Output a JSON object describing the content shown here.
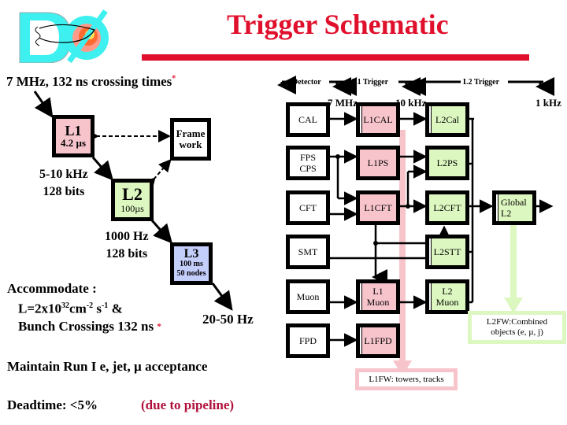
{
  "header": {
    "title": "Trigger Schematic",
    "logo": "d0-logo"
  },
  "left": {
    "crossing_line": "7 MHz, 132 ns crossing times",
    "crossing_star": "*",
    "l1": {
      "name": "L1",
      "latency": "4.2 µs"
    },
    "framework": {
      "line1": "Frame",
      "line2": "work"
    },
    "l1_rate": {
      "line1": "5-10 kHz",
      "line2": "128 bits"
    },
    "l2": {
      "name": "L2",
      "latency": "100µs"
    },
    "l2_rate": {
      "line1": "1000 Hz",
      "line2": "128 bits"
    },
    "l3": {
      "name": "L3",
      "line1": "100 ms",
      "line2": "50 nodes"
    },
    "l3_rate": "20-50 Hz",
    "accommodate": {
      "line1": "Accommodate :",
      "lum_prefix": "L=2x10",
      "lum_exp": "32",
      "lum_unit": "cm",
      "lum_unit_exp": "-2",
      "lum_s": " s",
      "lum_s_exp": "-1",
      "lum_suffix": " &",
      "line3": "Bunch Crossings 132 ns",
      "star": "*"
    },
    "maintain": "Maintain Run I e, jet, µ acceptance",
    "deadtime": "Deadtime:  <5%",
    "deadtime_note": "(due to pipeline)"
  },
  "right": {
    "stages": {
      "detector": "Detector",
      "l1": "L1 Trigger",
      "l2": "L2 Trigger"
    },
    "rates": {
      "r1": "7 MHz",
      "r2": "10 kHz",
      "r3": "1 kHz"
    },
    "detectors": [
      "CAL",
      "FPS\nCPS",
      "CFT",
      "SMT",
      "Muon",
      "FPD"
    ],
    "l1_boxes": [
      "L1CAL",
      "L1PS",
      "L1CFT",
      "L1\nMuon",
      "L1FPD"
    ],
    "l2_boxes": [
      "L2Cal",
      "L2PS",
      "L2CFT",
      "L2STT",
      "L2\nMuon"
    ],
    "global": "Global\nL2",
    "l1fw": "L1FW: towers, tracks",
    "l2fw": {
      "line1": "L2FW:Combined",
      "line2": "objects  (e, µ, j)"
    }
  },
  "colors": {
    "accent": "#e0102c",
    "l1_pink": "#f7c4cc",
    "l2_green": "#ddf7c0",
    "l3_blue": "#c4cefa",
    "logo_cyan": "#3ff0f0"
  }
}
